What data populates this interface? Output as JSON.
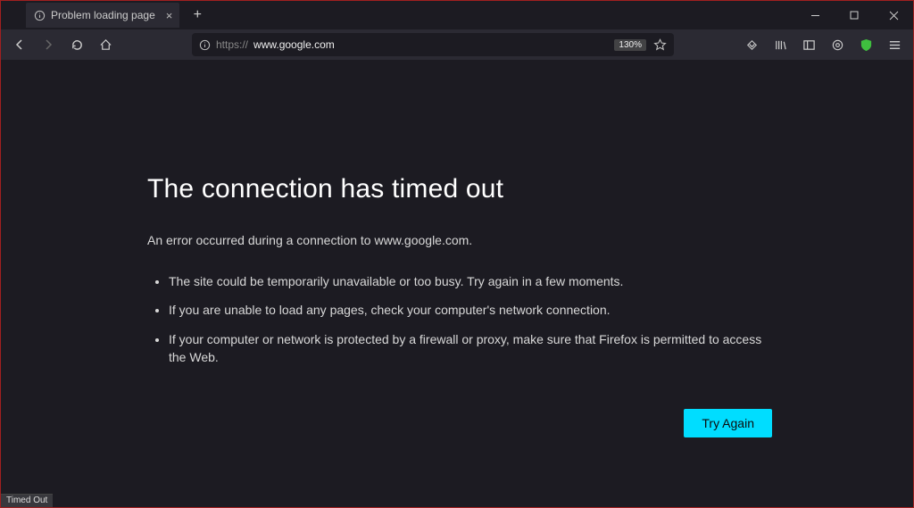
{
  "window": {
    "tab_title": "Problem loading page"
  },
  "navbar": {
    "url_protocol": "https://",
    "url_host": "www.google.com",
    "zoom": "130%"
  },
  "error": {
    "title": "The connection has timed out",
    "message": "An error occurred during a connection to www.google.com.",
    "bullets": [
      "The site could be temporarily unavailable or too busy. Try again in a few moments.",
      "If you are unable to load any pages, check your computer's network connection.",
      "If your computer or network is protected by a firewall or proxy, make sure that Firefox is permitted to access the Web."
    ],
    "try_again_label": "Try Again"
  },
  "status": {
    "text": "Timed Out"
  }
}
